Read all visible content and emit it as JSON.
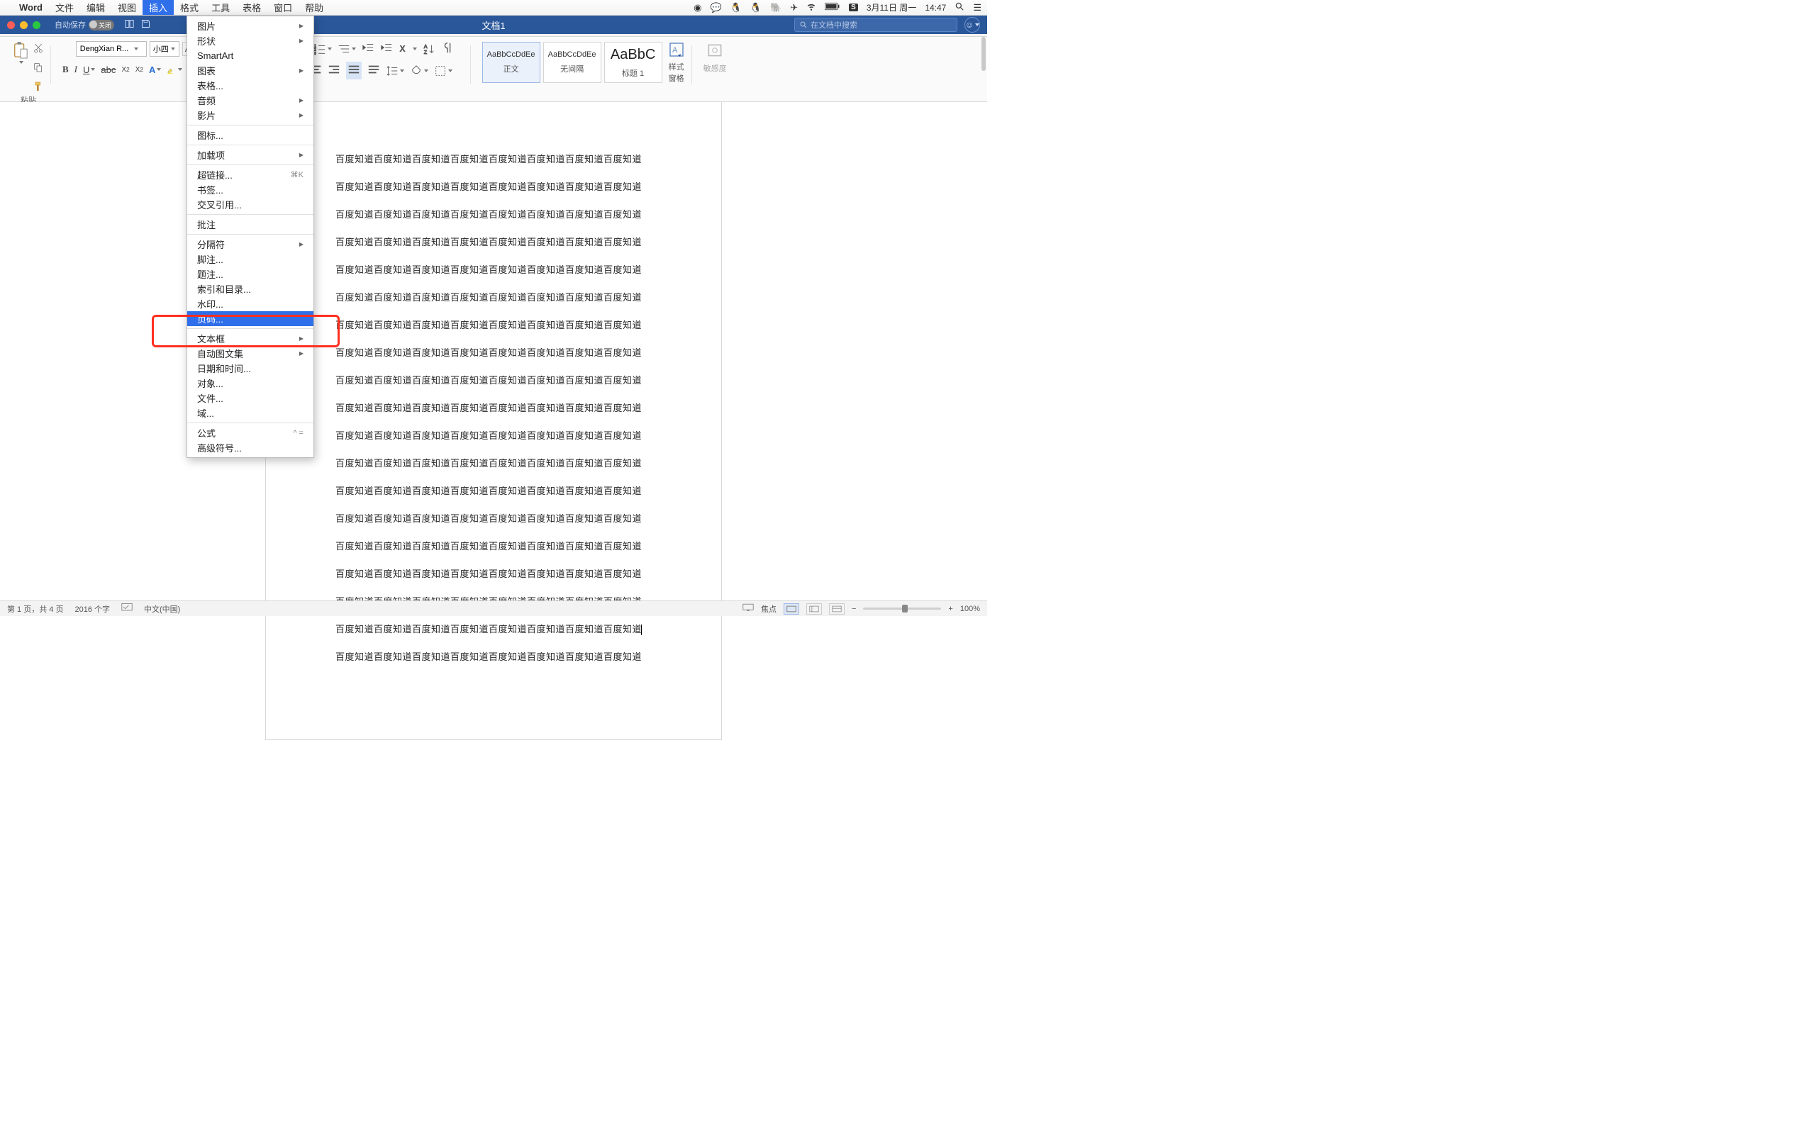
{
  "menubar": {
    "apple": "",
    "appname": "Word",
    "items": [
      "文件",
      "编辑",
      "视图",
      "插入",
      "格式",
      "工具",
      "表格",
      "窗口",
      "帮助"
    ],
    "active_index": 3,
    "right": {
      "date": "3月11日 周一",
      "time": "14:47"
    }
  },
  "titlebar": {
    "autosave_label": "自动保存",
    "autosave_state": "关闭",
    "doc_title": "文档1",
    "search_placeholder": "在文档中搜索"
  },
  "ribbon": {
    "paste_label": "粘贴",
    "font_name": "DengXian R...",
    "font_size": "小四",
    "styles": [
      {
        "preview": "AaBbCcDdEe",
        "name": "正文",
        "selected": true,
        "big": false
      },
      {
        "preview": "AaBbCcDdEe",
        "name": "无间隔",
        "selected": false,
        "big": false
      },
      {
        "preview": "AaBbC",
        "name": "标题 1",
        "selected": false,
        "big": true
      }
    ],
    "style_pane": "样式\n窗格",
    "sensitivity": "敏感度"
  },
  "dropdown": {
    "groups": [
      [
        {
          "label": "图片",
          "sub": true
        },
        {
          "label": "形状",
          "sub": true
        },
        {
          "label": "SmartArt"
        },
        {
          "label": "图表",
          "sub": true
        },
        {
          "label": "表格..."
        },
        {
          "label": "音频",
          "sub": true
        },
        {
          "label": "影片",
          "sub": true
        }
      ],
      [
        {
          "label": "图标..."
        }
      ],
      [
        {
          "label": "加载项",
          "sub": true
        }
      ],
      [
        {
          "label": "超链接...",
          "shortcut": "⌘K"
        },
        {
          "label": "书签..."
        },
        {
          "label": "交叉引用..."
        }
      ],
      [
        {
          "label": "批注"
        }
      ],
      [
        {
          "label": "分隔符",
          "sub": true
        },
        {
          "label": "脚注..."
        },
        {
          "label": "题注..."
        },
        {
          "label": "索引和目录..."
        },
        {
          "label": "水印..."
        },
        {
          "label": "页码...",
          "selected": true
        }
      ],
      [
        {
          "label": "文本框",
          "sub": true
        },
        {
          "label": "自动图文集",
          "sub": true
        },
        {
          "label": "日期和时间..."
        },
        {
          "label": "对象..."
        },
        {
          "label": "文件..."
        },
        {
          "label": "域..."
        }
      ],
      [
        {
          "label": "公式",
          "shortcut": "^ ="
        },
        {
          "label": "高级符号..."
        }
      ]
    ]
  },
  "document": {
    "line": "百度知道百度知道百度知道百度知道百度知道百度知道百度知道百度知道",
    "line_count": 19
  },
  "status": {
    "page": "第 1 页，共 4 页",
    "words": "2016 个字",
    "lang": "中文(中国)",
    "focus": "焦点",
    "zoom": "100%"
  }
}
